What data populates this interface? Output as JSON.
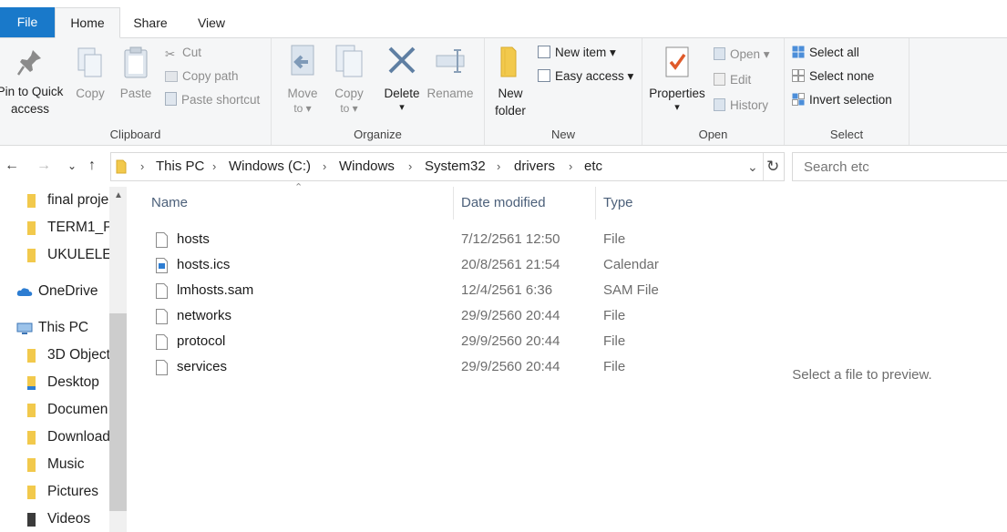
{
  "tabs": {
    "file": "File",
    "home": "Home",
    "share": "Share",
    "view": "View"
  },
  "ribbon": {
    "clipboard": {
      "pin_line1": "Pin to Quick",
      "pin_line2": "access",
      "copy": "Copy",
      "paste": "Paste",
      "cut": "Cut",
      "copy_path": "Copy path",
      "paste_shortcut": "Paste shortcut",
      "label": "Clipboard"
    },
    "organize": {
      "move_to_1": "Move",
      "move_to_2": "to",
      "copy_to_1": "Copy",
      "copy_to_2": "to",
      "delete": "Delete",
      "rename": "Rename",
      "label": "Organize"
    },
    "new": {
      "new_folder_1": "New",
      "new_folder_2": "folder",
      "new_item": "New item",
      "easy_access": "Easy access",
      "label": "New"
    },
    "open": {
      "properties": "Properties",
      "open": "Open",
      "edit": "Edit",
      "history": "History",
      "label": "Open"
    },
    "select": {
      "select_all": "Select all",
      "select_none": "Select none",
      "invert_selection": "Invert selection",
      "label": "Select"
    }
  },
  "address": {
    "crumbs": [
      "This PC",
      "Windows (C:)",
      "Windows",
      "System32",
      "drivers",
      "etc"
    ],
    "search_placeholder": "Search etc"
  },
  "nav": {
    "items": [
      "final proje",
      "TERM1_P",
      "UKULELE",
      "OneDrive",
      "This PC",
      "3D Object",
      "Desktop",
      "Documen",
      "Download",
      "Music",
      "Pictures",
      "Videos"
    ]
  },
  "files": {
    "columns": {
      "name": "Name",
      "date": "Date modified",
      "type": "Type"
    },
    "rows": [
      {
        "name": "hosts",
        "date": "7/12/2561 12:50",
        "type": "File"
      },
      {
        "name": "hosts.ics",
        "date": "20/8/2561 21:54",
        "type": "Calendar"
      },
      {
        "name": "lmhosts.sam",
        "date": "12/4/2561 6:36",
        "type": "SAM File"
      },
      {
        "name": "networks",
        "date": "29/9/2560 20:44",
        "type": "File"
      },
      {
        "name": "protocol",
        "date": "29/9/2560 20:44",
        "type": "File"
      },
      {
        "name": "services",
        "date": "29/9/2560 20:44",
        "type": "File"
      }
    ]
  },
  "preview": {
    "text": "Select a file to preview."
  },
  "colors": {
    "accent": "#1979ca",
    "folder": "#f2c94c",
    "header_text": "#4c607a"
  }
}
